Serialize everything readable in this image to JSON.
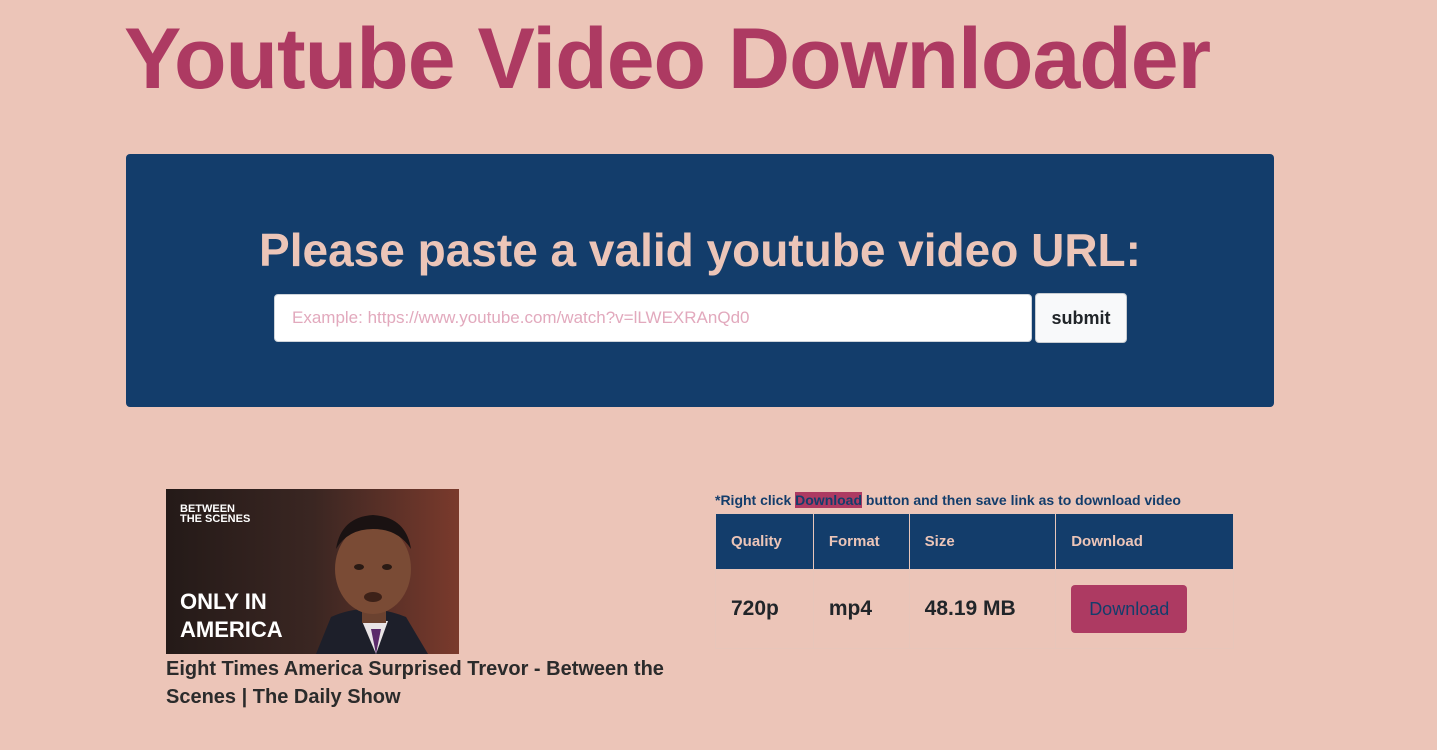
{
  "header": {
    "title": "Youtube Video Downloader"
  },
  "search": {
    "heading": "Please paste a valid youtube video URL:",
    "placeholder": "Example: https://www.youtube.com/watch?v=lLWEXRAnQd0",
    "value": "",
    "submit_label": "submit"
  },
  "video": {
    "thumbnail": {
      "badge_line1": "BETWEEN",
      "badge_line2": "THE SCENES",
      "caption_line1": "ONLY IN",
      "caption_line2": "AMERICA"
    },
    "title": "Eight Times America Surprised Trevor - Between the Scenes | The Daily Show"
  },
  "downloads": {
    "note_prefix": "*Right click ",
    "note_highlight": "Download",
    "note_suffix": " button and then save link as to download video",
    "columns": [
      "Quality",
      "Format",
      "Size",
      "Download"
    ],
    "rows": [
      {
        "quality": "720p",
        "format": "mp4",
        "size": "48.19 MB",
        "button_label": "Download"
      }
    ]
  },
  "colors": {
    "background": "#ecc5b8",
    "brand_pink": "#ad3a62",
    "navy": "#133d6b"
  }
}
